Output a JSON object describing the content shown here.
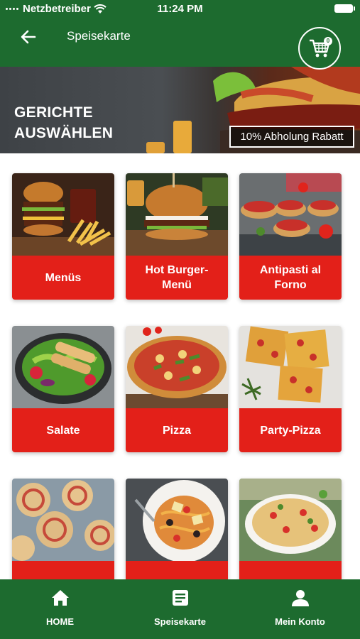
{
  "status_bar": {
    "carrier": "Netzbetreiber",
    "time": "11:24 PM"
  },
  "header": {
    "title": "Speisekarte",
    "cart_count": "0"
  },
  "banner": {
    "title_line1": "GERICHTE",
    "title_line2": "AUSWÄHLEN",
    "discount": "10% Abholung Rabatt"
  },
  "categories": [
    {
      "label": "Menüs"
    },
    {
      "label": "Hot Burger-Menü"
    },
    {
      "label": "Antipasti al Forno"
    },
    {
      "label": "Salate"
    },
    {
      "label": "Pizza"
    },
    {
      "label": "Party-Pizza"
    },
    {
      "label": ""
    },
    {
      "label": ""
    },
    {
      "label": ""
    }
  ],
  "bottom_nav": [
    {
      "label": "HOME",
      "icon": "home-icon"
    },
    {
      "label": "Speisekarte",
      "icon": "menu-document-icon"
    },
    {
      "label": "Mein Konto",
      "icon": "user-icon"
    }
  ],
  "colors": {
    "primary_green": "#1d6b2f",
    "category_red": "#e32019"
  }
}
